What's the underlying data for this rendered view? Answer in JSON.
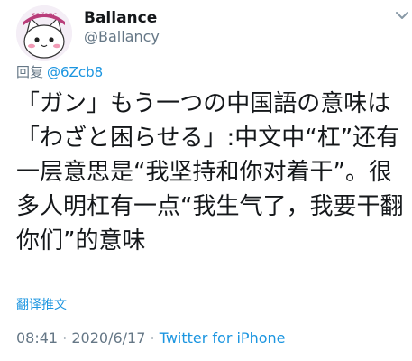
{
  "author": {
    "display_name": "Ballance",
    "handle": "@Ballancy",
    "avatar_text": "sallanc"
  },
  "reply": {
    "prefix": "回复",
    "target": "@6Zcb8"
  },
  "tweet": {
    "text": "「ガン」もう一つの中国語の意味は「わざと困らせる」:中文中“杠”还有一层意思是“我坚持和你对着干”。很多人明杠有一点“我生气了，我要干翻你们”的意味"
  },
  "translate_label": "翻译推文",
  "meta": {
    "time": "08:41",
    "separator1": " · ",
    "date": "2020/6/17",
    "separator2": " · ",
    "source": "Twitter for iPhone"
  },
  "colors": {
    "link": "#1b95e0",
    "secondary": "#657786",
    "text": "#14171a"
  }
}
